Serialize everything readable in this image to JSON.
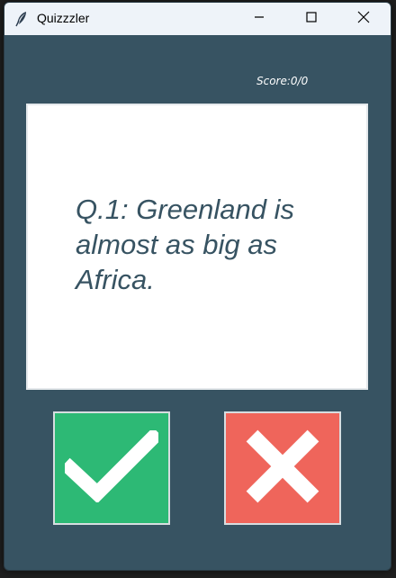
{
  "window": {
    "title": "Quizzzler"
  },
  "score": {
    "text": "Score:0/0"
  },
  "question": {
    "text": "Q.1: Greenland is almost as big as Africa."
  },
  "buttons": {
    "true_icon": "checkmark-icon",
    "false_icon": "cross-icon"
  },
  "colors": {
    "background": "#375362",
    "true_button": "#2db975",
    "false_button": "#ef655b",
    "question_text": "#375362"
  }
}
